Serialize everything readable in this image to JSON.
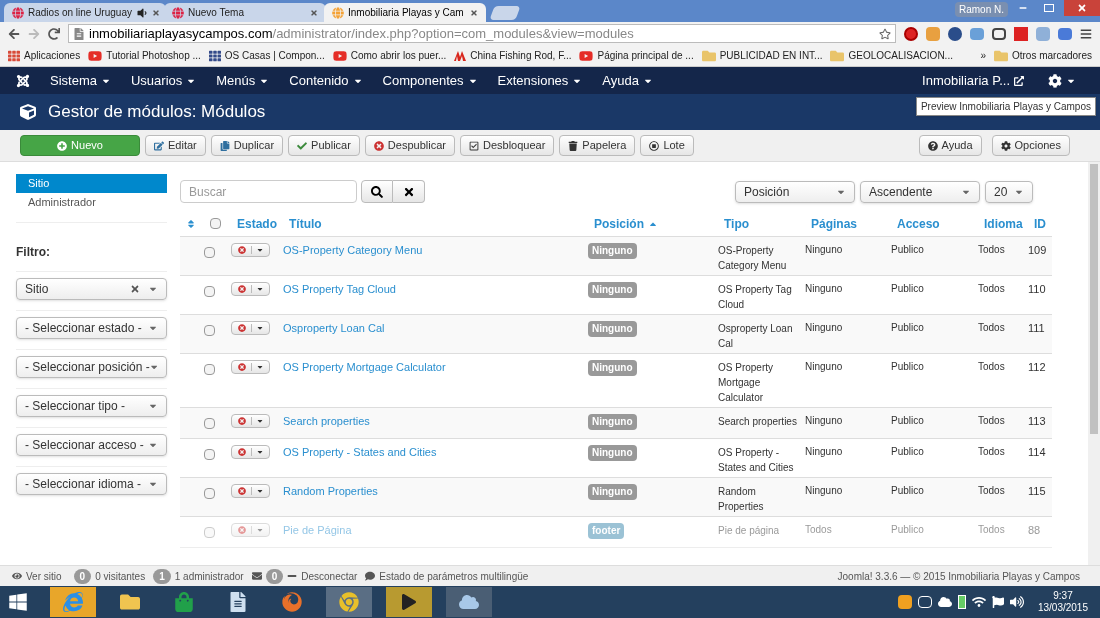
{
  "browser": {
    "tabs": [
      {
        "title": "Radios on line Uruguay",
        "selected": false,
        "audio": true
      },
      {
        "title": "Nuevo Tema",
        "selected": false,
        "audio": false
      },
      {
        "title": "Inmobiliaria Playas y Cam",
        "selected": true,
        "audio": false
      }
    ],
    "user": "Ramon N.",
    "url_host": "inmobiliariaplayasycampos.com",
    "url_path": "/administrator/index.php?option=com_modules&view=modules",
    "bookmarks": [
      {
        "label": "Aplicaciones",
        "kind": "apps"
      },
      {
        "label": "Tutorial Photoshop ...",
        "kind": "video"
      },
      {
        "label": "OS Casas | Compon...",
        "kind": "grid"
      },
      {
        "label": "Como abrir los puer...",
        "kind": "video"
      },
      {
        "label": "China Fishing Rod, F...",
        "kind": "brand"
      },
      {
        "label": "Página principal de ...",
        "kind": "video"
      },
      {
        "label": "PUBLICIDAD EN INT...",
        "kind": "folder"
      },
      {
        "label": "GEOLOCALISACION...",
        "kind": "folder"
      }
    ],
    "bookmarks_more": "»",
    "other_bookmarks": "Otros marcadores"
  },
  "nav": {
    "menus": [
      "Sistema",
      "Usuarios",
      "Menús",
      "Contenido",
      "Componentes",
      "Extensiones",
      "Ayuda"
    ],
    "site": "Inmobiliaria P..."
  },
  "header": {
    "title": "Gestor de módulos: Módulos",
    "tooltip": "Preview Inmobiliaria Playas y Campos"
  },
  "toolbar": {
    "buttons": [
      {
        "label": "Nuevo",
        "kind": "primary"
      },
      {
        "label": "Editar",
        "kind": "default"
      },
      {
        "label": "Duplicar",
        "kind": "default"
      },
      {
        "label": "Publicar",
        "kind": "default"
      },
      {
        "label": "Despublicar",
        "kind": "default"
      },
      {
        "label": "Desbloquear",
        "kind": "default"
      },
      {
        "label": "Papelera",
        "kind": "default"
      },
      {
        "label": "Lote",
        "kind": "default"
      }
    ],
    "right_buttons": [
      "Ayuda",
      "Opciones"
    ]
  },
  "sidebar": {
    "items": [
      {
        "label": "Sitio",
        "selected": true
      },
      {
        "label": "Administrador",
        "selected": false
      }
    ],
    "filter_label": "Filtro:",
    "filters": [
      {
        "value": "Sitio",
        "clearable": true
      },
      {
        "value": "- Seleccionar estado -",
        "clearable": false
      },
      {
        "value": "- Seleccionar posición -",
        "clearable": false
      },
      {
        "value": "- Seleccionar tipo -",
        "clearable": false
      },
      {
        "value": "- Seleccionar acceso -",
        "clearable": false
      },
      {
        "value": "- Seleccionar idioma -",
        "clearable": false
      }
    ]
  },
  "search": {
    "placeholder": "Buscar"
  },
  "sort_selects": [
    "Posición",
    "Ascendente",
    "20"
  ],
  "table": {
    "select_all_checked": false,
    "columns": [
      {
        "label": "Estado",
        "sorted": false
      },
      {
        "label": "Título",
        "sorted": false
      },
      {
        "label": "Posición",
        "sorted": true
      },
      {
        "label": "Tipo",
        "sorted": false
      },
      {
        "label": "Páginas",
        "sorted": false
      },
      {
        "label": "Acceso",
        "sorted": false
      },
      {
        "label": "Idioma",
        "sorted": false
      },
      {
        "label": "ID",
        "sorted": false
      }
    ],
    "rows": [
      {
        "title": "OS-Property Category Menu",
        "position": "Ninguno",
        "assigned": false,
        "type": "OS-Property Category Menu",
        "pages": "Ninguno",
        "access": "Publico",
        "language": "Todos",
        "id": "109",
        "checked": false,
        "published": false,
        "dimmed": false
      },
      {
        "title": "OS Property Tag Cloud",
        "position": "Ninguno",
        "assigned": false,
        "type": "OS Property Tag Cloud",
        "pages": "Ninguno",
        "access": "Publico",
        "language": "Todos",
        "id": "110",
        "checked": false,
        "published": false,
        "dimmed": false
      },
      {
        "title": "Osproperty Loan Cal",
        "position": "Ninguno",
        "assigned": false,
        "type": "Osproperty Loan Cal",
        "pages": "Ninguno",
        "access": "Publico",
        "language": "Todos",
        "id": "111",
        "checked": false,
        "published": false,
        "dimmed": false
      },
      {
        "title": "OS Property Mortgage Calculator",
        "position": "Ninguno",
        "assigned": false,
        "type": "OS Property Mortgage Calculator",
        "pages": "Ninguno",
        "access": "Publico",
        "language": "Todos",
        "id": "112",
        "checked": false,
        "published": false,
        "dimmed": false
      },
      {
        "title": "Search properties",
        "position": "Ninguno",
        "assigned": false,
        "type": "Search properties",
        "pages": "Ninguno",
        "access": "Publico",
        "language": "Todos",
        "id": "113",
        "checked": false,
        "published": false,
        "dimmed": false
      },
      {
        "title": "OS Property - States and Cities",
        "position": "Ninguno",
        "assigned": false,
        "type": "OS Property - States and Cities",
        "pages": "Ninguno",
        "access": "Publico",
        "language": "Todos",
        "id": "114",
        "checked": false,
        "published": false,
        "dimmed": false
      },
      {
        "title": "Random Properties",
        "position": "Ninguno",
        "assigned": false,
        "type": "Random Properties",
        "pages": "Ninguno",
        "access": "Publico",
        "language": "Todos",
        "id": "115",
        "checked": false,
        "published": false,
        "dimmed": false
      },
      {
        "title": "Pie de Página",
        "position": "footer",
        "assigned": true,
        "type": "Pie de página",
        "pages": "Todos",
        "access": "Publico",
        "language": "Todos",
        "id": "88",
        "checked": false,
        "published": false,
        "dimmed": true
      }
    ]
  },
  "status_bar": {
    "view_site": "Ver sitio",
    "visitors_count": "0",
    "visitors": "0 visitantes",
    "admins_count": "1",
    "admins": "1 administrador",
    "messages_count": "0",
    "logout": "Desconectar",
    "multilang": "Estado de parámetros multilingüe",
    "version": "Joomla! 3.3.6 — © 2015 Inmobiliaria Playas y Campos"
  },
  "taskbar": {
    "time": "9:37",
    "date": "13/03/2015"
  }
}
